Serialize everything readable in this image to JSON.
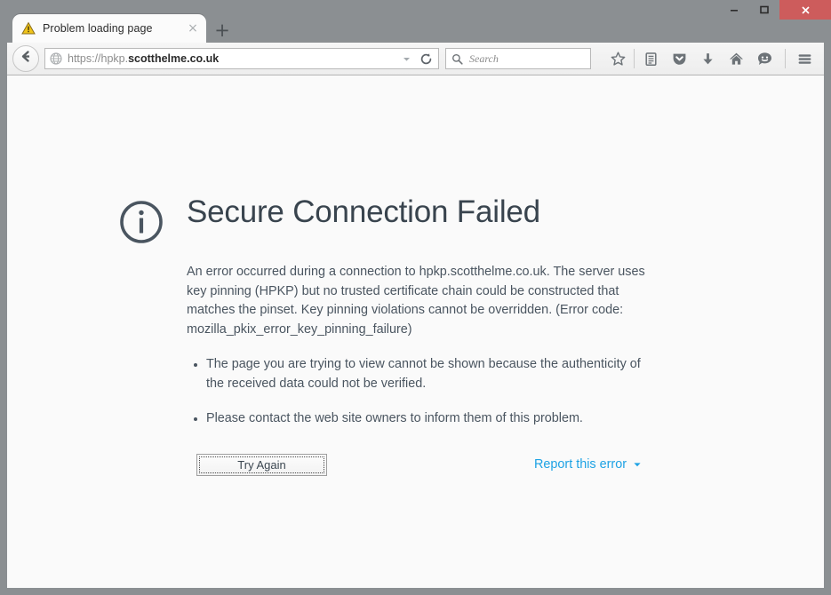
{
  "window": {
    "controls": {
      "minimize_label": "Minimize",
      "maximize_label": "Maximize",
      "close_label": "Close",
      "close_glyph": "✕",
      "close_color": "#cd5c5c"
    },
    "frame_color": "#8b8f92"
  },
  "tabstrip": {
    "tabs": [
      {
        "title": "Problem loading page",
        "favicon": "warning-triangle-icon",
        "close_glyph": "×",
        "active": true
      }
    ],
    "new_tab_glyph": "+",
    "new_tab_label": "New Tab"
  },
  "toolbar": {
    "back_label": "Back",
    "back_icon": "arrow-left-icon",
    "url": {
      "favicon": "globe-icon",
      "prefix": "https://hpkp.",
      "domain": "scotthelme.co.uk",
      "full": "https://hpkp.scotthelme.co.uk",
      "dropdown_icon": "chevron-down-icon",
      "reload_icon": "reload-icon",
      "reload_label": "Reload"
    },
    "search": {
      "placeholder": "Search",
      "icon": "search-icon"
    },
    "icons": [
      {
        "name": "star-icon",
        "label": "Bookmark this page"
      },
      {
        "name": "reader-list-icon",
        "label": "Show your bookmarks"
      },
      {
        "name": "pocket-icon",
        "label": "Save to Pocket"
      },
      {
        "name": "download-icon",
        "label": "Downloads"
      },
      {
        "name": "home-icon",
        "label": "Home"
      },
      {
        "name": "feedback-smiley-icon",
        "label": "Send Feedback"
      },
      {
        "name": "hamburger-menu-icon",
        "label": "Open menu"
      }
    ]
  },
  "error_page": {
    "icon": "info-circle-icon",
    "title": "Secure Connection Failed",
    "paragraph": "An error occurred during a connection to hpkp.scotthelme.co.uk. The server uses key pinning (HPKP) but no trusted certificate chain could be constructed that matches the pinset. Key pinning violations cannot be overridden. (Error code: mozilla_pkix_error_key_pinning_failure)",
    "bullets": [
      "The page you are trying to view cannot be shown because the authenticity of the received data could not be verified.",
      "Please contact the web site owners to inform them of this problem."
    ],
    "try_again_label": "Try Again",
    "report_link_label": "Report this error",
    "report_caret": "▾",
    "link_color": "#1ea2e4",
    "title_color": "#39444e",
    "text_color": "#4a5560",
    "background_color": "#fafafa"
  }
}
